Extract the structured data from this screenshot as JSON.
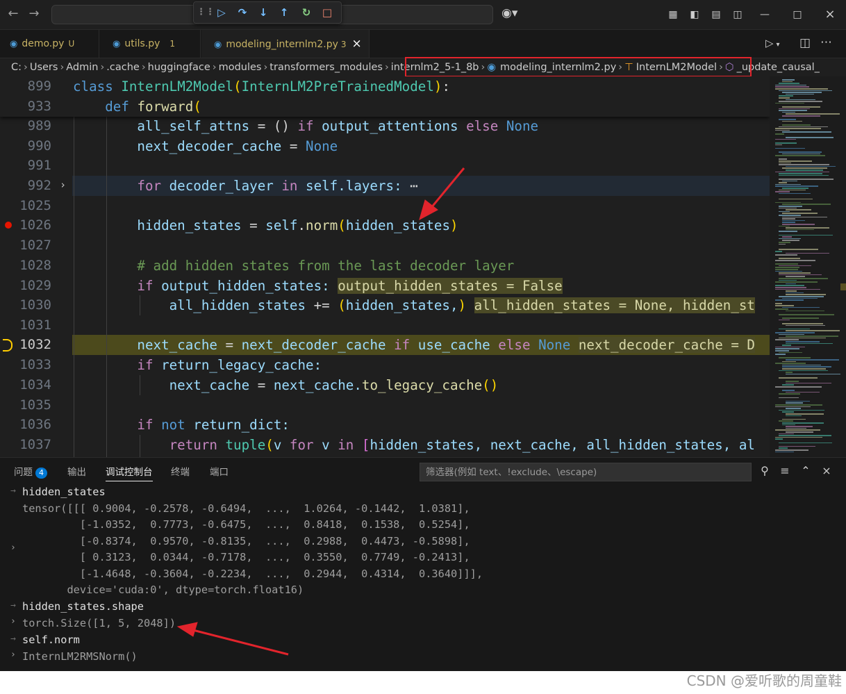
{
  "titlebar": {
    "back_icon": "arrow-left-icon",
    "forward_icon": "arrow-right-icon",
    "search_text": "",
    "debug_actions": [
      "continue",
      "step-over",
      "step-into",
      "step-out",
      "restart",
      "stop"
    ],
    "copilot_icon": "copilot-icon",
    "layout_icons": [
      "customize-layout",
      "toggle-primary-sidebar",
      "toggle-panel",
      "toggle-secondary-sidebar"
    ],
    "window_controls": [
      "minimize",
      "maximize",
      "close"
    ]
  },
  "tabs": [
    {
      "label": "demo.py",
      "badge": "U"
    },
    {
      "label": "utils.py",
      "badge": "1"
    },
    {
      "label": "modeling_internlm2.py",
      "badge": "3",
      "active": true
    }
  ],
  "breadcrumb": [
    "C:",
    "Users",
    "Admin",
    ".cache",
    "huggingface",
    "modules",
    "transformers_modules",
    "internlm2_5-1_8b",
    "modeling_internlm2.py",
    "InternLM2Model",
    "_update_causal_"
  ],
  "editor": {
    "sticky": [
      {
        "ln": "899",
        "text": "class InternLM2Model(InternLM2PreTrainedModel):"
      },
      {
        "ln": "933",
        "text": "    def forward("
      }
    ],
    "lines": [
      {
        "ln": "989"
      },
      {
        "ln": "990"
      },
      {
        "ln": "991"
      },
      {
        "ln": "992"
      },
      {
        "ln": "1025"
      },
      {
        "ln": "1026"
      },
      {
        "ln": "1027"
      },
      {
        "ln": "1028"
      },
      {
        "ln": "1029"
      },
      {
        "ln": "1030"
      },
      {
        "ln": "1031"
      },
      {
        "ln": "1032"
      },
      {
        "ln": "1033"
      },
      {
        "ln": "1034"
      },
      {
        "ln": "1035"
      },
      {
        "ln": "1036"
      },
      {
        "ln": "1037"
      }
    ],
    "code": {
      "l989a": "all_self_attns",
      "l989b": " = () ",
      "l989c": "if",
      "l989d": " output_attentions ",
      "l989e": "else",
      "l989f": " None",
      "l990a": "next_decoder_cache",
      "l990b": " = ",
      "l990c": "None",
      "l992a": "for",
      "l992b": " decoder_layer ",
      "l992c": "in",
      "l992d": " self.layers:",
      "l992e": " ⋯",
      "l1026a": "hidden_states",
      "l1026b": " = ",
      "l1026c": "self",
      "l1026d": ".",
      "l1026e": "norm",
      "l1026f": "(",
      "l1026g": "hidden_states",
      "l1026h": ")",
      "l1028": "# add hidden states from the last decoder layer",
      "l1029a": "if",
      "l1029b": " output_hidden_states:",
      "l1029c": "output_hidden_states = False",
      "l1030a": "all_hidden_states",
      "l1030b": " += ",
      "l1030c": "(",
      "l1030d": "hidden_states,",
      "l1030e": ")",
      "l1030f": "all_hidden_states = None, hidden_st",
      "l1032a": "next_cache",
      "l1032b": " = ",
      "l1032c": "next_decoder_cache ",
      "l1032d": "if",
      "l1032e": " use_cache ",
      "l1032f": "else",
      "l1032g": " None",
      "l1032h": "next_decoder_cache = D",
      "l1033a": "if",
      "l1033b": " return_legacy_cache:",
      "l1034a": "next_cache",
      "l1034b": " = ",
      "l1034c": "next_cache.",
      "l1034d": "to_legacy_cache",
      "l1034e": "()",
      "l1036a": "if",
      "l1036b": " not",
      "l1036c": " return_dict:",
      "l1037a": "return",
      "l1037b": " tuple",
      "l1037c": "(",
      "l1037d": "v ",
      "l1037e": "for",
      "l1037f": " v ",
      "l1037g": "in",
      "l1037h": " [",
      "l1037i": "hidden_states, next_cache, all_hidden_states, al"
    },
    "breakpoint_line": "1026",
    "current_line": "1032",
    "fold_line": "992"
  },
  "panel": {
    "tabs": [
      "问题",
      "输出",
      "调试控制台",
      "终端",
      "端口"
    ],
    "active_tab": "调试控制台",
    "problems_count": "4",
    "filter_placeholder": "筛选器(例如 text、!exclude、\\escape)",
    "console": [
      {
        "kind": "in",
        "text": "hidden_states"
      },
      {
        "kind": "out",
        "text": "tensor([[[ 0.9004, -0.2578, -0.6494,  ...,  1.0264, -0.1442,  1.0381],"
      },
      {
        "kind": "out",
        "text": "         [-1.0352,  0.7773, -0.6475,  ...,  0.8418,  0.1538,  0.5254],"
      },
      {
        "kind": "out",
        "text": "         [-0.8374,  0.9570, -0.8135,  ...,  0.2988,  0.4473, -0.5898],"
      },
      {
        "kind": "out",
        "text": "         [ 0.3123,  0.0344, -0.7178,  ...,  0.3550,  0.7749, -0.2413],"
      },
      {
        "kind": "out",
        "text": "         [-1.4648, -0.3604, -0.2234,  ...,  0.2944,  0.4314,  0.3640]]],"
      },
      {
        "kind": "out",
        "text": "       device='cuda:0', dtype=torch.float16)"
      },
      {
        "kind": "in",
        "text": "hidden_states.shape"
      },
      {
        "kind": "out",
        "text": "torch.Size([1, 5, 2048])"
      },
      {
        "kind": "in",
        "text": "self.norm"
      },
      {
        "kind": "out",
        "text": "InternLM2RMSNorm()"
      }
    ]
  },
  "watermark": "CSDN @爱听歌的周童鞋",
  "annotation_color": "#e2242c"
}
